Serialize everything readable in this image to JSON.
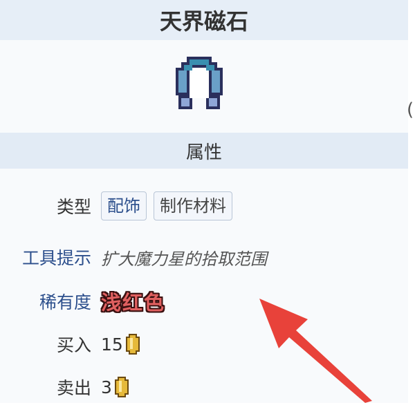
{
  "item": {
    "title": "天界磁石",
    "icon": "celestial-magnet-icon"
  },
  "edge_glyph": "(",
  "section": {
    "title": "属性"
  },
  "properties": {
    "type": {
      "label": "类型",
      "tags": [
        "配饰",
        "制作材料"
      ]
    },
    "tooltip": {
      "label": "工具提示",
      "value": "扩大魔力星的拾取范围"
    },
    "rarity": {
      "label": "稀有度",
      "value": "浅红色",
      "color": "#e06060"
    },
    "buy": {
      "label": "买入",
      "value": "15",
      "currency_icon": "gold-coin-icon"
    },
    "sell": {
      "label": "卖出",
      "value": "3",
      "currency_icon": "gold-coin-icon"
    }
  },
  "colors": {
    "header_bg": "#e6eef7",
    "link": "#2c4f8c",
    "arrow": "#e8423a"
  }
}
